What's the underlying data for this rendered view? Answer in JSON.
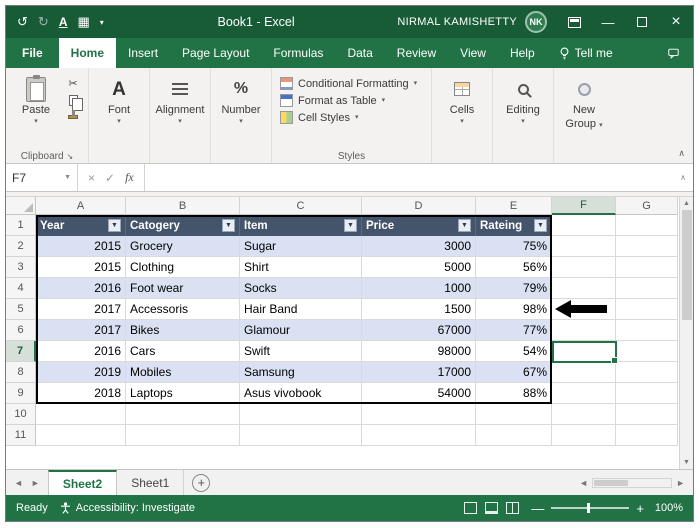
{
  "titlebar": {
    "title": "Book1 - Excel",
    "user_name": "NIRMAL KAMISHETTY",
    "avatar_initials": "NK",
    "qat_icons": [
      {
        "name": "undo-icon",
        "glyph": "↺"
      },
      {
        "name": "redo-icon",
        "glyph": "↻"
      },
      {
        "name": "underline-icon",
        "glyph": "A"
      },
      {
        "name": "table-icon",
        "glyph": "▦"
      },
      {
        "name": "qat-more-icon",
        "glyph": "▾"
      }
    ]
  },
  "ribbon_tabs": {
    "items": [
      {
        "label": "File",
        "active": false
      },
      {
        "label": "Home",
        "active": true
      },
      {
        "label": "Insert",
        "active": false
      },
      {
        "label": "Page Layout",
        "active": false
      },
      {
        "label": "Formulas",
        "active": false
      },
      {
        "label": "Data",
        "active": false
      },
      {
        "label": "Review",
        "active": false
      },
      {
        "label": "View",
        "active": false
      },
      {
        "label": "Help",
        "active": false
      },
      {
        "label": "Tell me",
        "active": false
      }
    ]
  },
  "ribbon": {
    "paste_label": "Paste",
    "clipboard_group_label": "Clipboard",
    "font_big_label": "A",
    "font_label": "Font",
    "alignment_label": "Alignment",
    "number_big_label": "%",
    "number_label": "Number",
    "styles_buttons": [
      {
        "label": "Conditional Formatting"
      },
      {
        "label": "Format as Table"
      },
      {
        "label": "Cell Styles"
      }
    ],
    "styles_group_label": "Styles",
    "cells_label": "Cells",
    "editing_label": "Editing",
    "new_group_line1": "New",
    "new_group_line2": "Group"
  },
  "formula_bar": {
    "name_box_value": "F7",
    "fx_label": "fx",
    "cancel_glyph": "×",
    "enter_glyph": "✓"
  },
  "grid": {
    "column_letters": [
      "A",
      "B",
      "C",
      "D",
      "E",
      "F",
      "G"
    ],
    "row_numbers": [
      1,
      2,
      3,
      4,
      5,
      6,
      7,
      8,
      9,
      10,
      11
    ],
    "selected_cell": "F7",
    "selected_column": "F",
    "selected_row": 7
  },
  "table": {
    "headers": [
      "Year",
      "Catogery",
      "Item",
      "Price",
      "Rateing"
    ],
    "rows": [
      [
        "2015",
        "Grocery",
        "Sugar",
        "3000",
        "75%"
      ],
      [
        "2015",
        "Clothing",
        "Shirt",
        "5000",
        "56%"
      ],
      [
        "2016",
        "Foot wear",
        "Socks",
        "1000",
        "79%"
      ],
      [
        "2017",
        "Accessoris",
        "Hair Band",
        "1500",
        "98%"
      ],
      [
        "2017",
        "Bikes",
        "Glamour",
        "67000",
        "77%"
      ],
      [
        "2016",
        "Cars",
        "Swift",
        "98000",
        "54%"
      ],
      [
        "2019",
        "Mobiles",
        "Samsung",
        "17000",
        "67%"
      ],
      [
        "2018",
        "Laptops",
        "Asus vivobook",
        "54000",
        "88%"
      ]
    ]
  },
  "sheet_tab_bar": {
    "tabs": [
      {
        "label": "Sheet2",
        "active": true
      },
      {
        "label": "Sheet1",
        "active": false
      }
    ],
    "add_button": "+"
  },
  "status_bar": {
    "mode": "Ready",
    "accessibility_label": "Accessibility: Investigate",
    "zoom_level": "100%"
  },
  "colors": {
    "titlebar_green": "#185C37",
    "ribbon_green": "#217346",
    "table_header_navy": "#44546A",
    "band_fill_blue": "#D9E1F2",
    "selection_green": "#217346",
    "annotation_arrow": "#000000"
  }
}
